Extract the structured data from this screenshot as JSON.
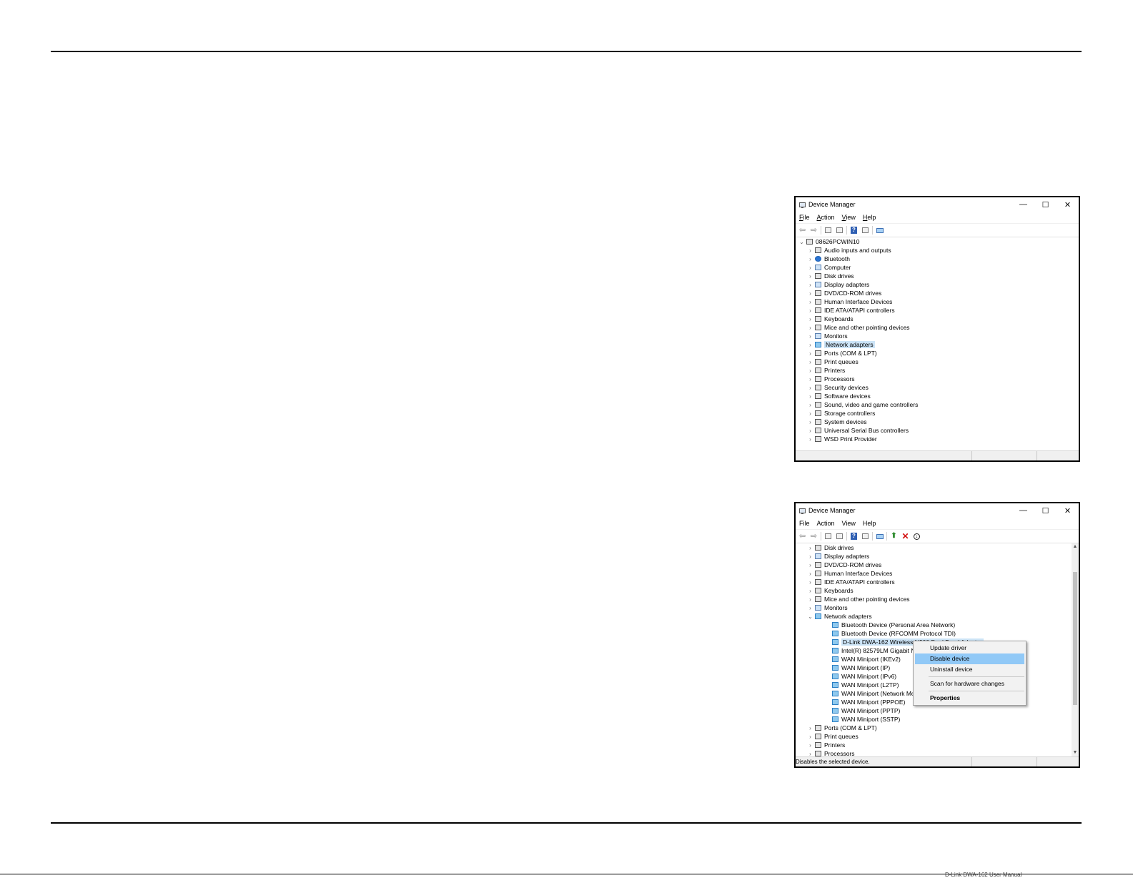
{
  "footer": {
    "note": "D-Link DWA-162 User Manual"
  },
  "window1": {
    "title": "Device Manager",
    "controls": {
      "minimize": "—",
      "maximize": "☐",
      "close": "✕"
    },
    "menu": [
      "File",
      "Action",
      "View",
      "Help"
    ],
    "root": "08626PCWIN10",
    "items": [
      "Audio inputs and outputs",
      "Bluetooth",
      "Computer",
      "Disk drives",
      "Display adapters",
      "DVD/CD-ROM drives",
      "Human Interface Devices",
      "IDE ATA/ATAPI controllers",
      "Keyboards",
      "Mice and other pointing devices",
      "Monitors",
      "Network adapters",
      "Ports (COM & LPT)",
      "Print queues",
      "Printers",
      "Processors",
      "Security devices",
      "Software devices",
      "Sound, video and game controllers",
      "Storage controllers",
      "System devices",
      "Universal Serial Bus controllers",
      "WSD Print Provider"
    ],
    "selected": "Network adapters"
  },
  "window2": {
    "title": "Device Manager",
    "controls": {
      "minimize": "—",
      "maximize": "☐",
      "close": "✕"
    },
    "menu": [
      "File",
      "Action",
      "View",
      "Help"
    ],
    "items_before": [
      "Disk drives",
      "Display adapters",
      "DVD/CD-ROM drives",
      "Human Interface Devices",
      "IDE ATA/ATAPI controllers",
      "Keyboards",
      "Mice and other pointing devices",
      "Monitors"
    ],
    "expanded": "Network adapters",
    "children": [
      "Bluetooth Device (Personal Area Network)",
      "Bluetooth Device (RFCOMM Protocol TDI)",
      "D-Link DWA-162 Wireless N900 Dual Band Adapter",
      "Intel(R) 82579LM Gigabit Network Connection",
      "WAN Miniport (IKEv2)",
      "WAN Miniport (IP)",
      "WAN Miniport (IPv6)",
      "WAN Miniport (L2TP)",
      "WAN Miniport (Network Monitor)",
      "WAN Miniport (PPPOE)",
      "WAN Miniport (PPTP)",
      "WAN Miniport (SSTP)"
    ],
    "selected_child": "D-Link DWA-162 Wireless N900 Dual Band Adapter",
    "items_after": [
      "Ports (COM & LPT)",
      "Print queues",
      "Printers",
      "Processors"
    ],
    "context_menu": {
      "items": [
        "Update driver",
        "Disable device",
        "Uninstall device",
        "Scan for hardware changes",
        "Properties"
      ],
      "highlighted": "Disable device"
    },
    "status": "Disables the selected device."
  },
  "colors": {
    "selection": "#cce4f7",
    "menu_highlight": "#91c9f7",
    "network_icon": "#8fc9ee"
  }
}
